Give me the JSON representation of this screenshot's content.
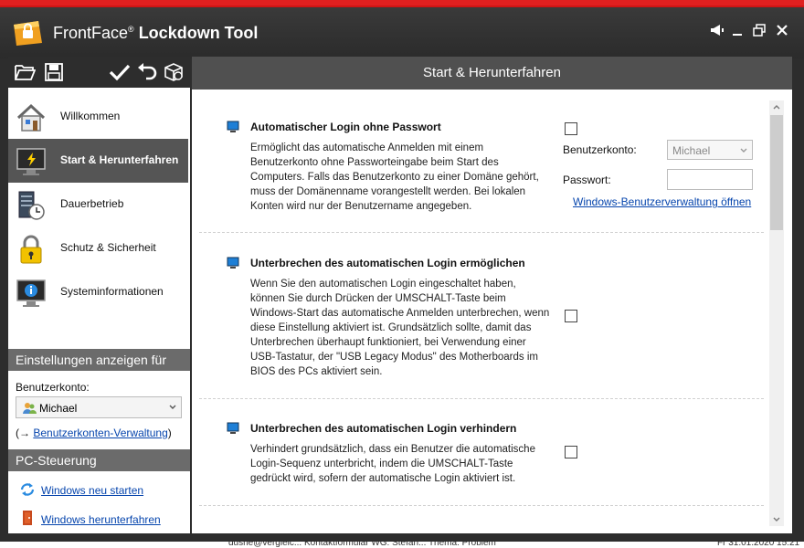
{
  "window": {
    "title_brand": "FrontFace",
    "title_reg": "®",
    "title_tool": "Lockdown Tool"
  },
  "toolbar": {
    "icons": [
      "folder-open-icon",
      "save-icon",
      "checkmark-icon",
      "undo-icon",
      "package-icon"
    ]
  },
  "nav": {
    "items": [
      {
        "label": "Willkommen",
        "icon": "house-icon"
      },
      {
        "label": "Start & Herunterfahren",
        "icon": "monitor-power-icon"
      },
      {
        "label": "Dauerbetrieb",
        "icon": "server-clock-icon"
      },
      {
        "label": "Schutz & Sicherheit",
        "icon": "padlock-icon"
      },
      {
        "label": "Systeminformationen",
        "icon": "info-monitor-icon"
      }
    ]
  },
  "settings_for": {
    "heading": "Einstellungen anzeigen für",
    "account_label": "Benutzerkonto:",
    "account_value": "Michael",
    "link_prefix": "(→ ",
    "link_text": "Benutzerkonten-Verwaltung",
    "link_suffix": ")"
  },
  "pc_control": {
    "heading": "PC-Steuerung",
    "restart_label": "Windows neu starten",
    "shutdown_label": "Windows herunterfahren"
  },
  "main": {
    "heading": "Start & Herunterfahren",
    "sections": [
      {
        "title": "Automatischer Login ohne Passwort",
        "description": "Ermöglicht das automatische Anmelden mit einem Benutzerkonto ohne Passworteingabe beim Start des Computers. Falls das Benutzerkonto zu einer Domäne gehört, muss der Domänenname vorangestellt werden. Bei lokalen Konten wird nur der Benutzername angegeben.",
        "checked": false,
        "account_label": "Benutzerkonto:",
        "account_value": "Michael",
        "password_label": "Passwort:",
        "password_value": "",
        "link": "Windows-Benutzerverwaltung öffnen"
      },
      {
        "title": "Unterbrechen des automatischen Login ermöglichen",
        "description": "Wenn Sie den automatischen Login eingeschaltet haben, können Sie durch Drücken der UMSCHALT-Taste beim Windows-Start das automatische Anmelden unterbrechen, wenn diese Einstellung aktiviert ist. Grundsätzlich sollte, damit das Unterbrechen überhaupt funktioniert, bei Verwendung einer USB-Tastatur, der \"USB Legacy Modus\" des Motherboards im BIOS des PCs aktiviert sein.",
        "checked": false
      },
      {
        "title": "Unterbrechen des automatischen Login verhindern",
        "description": "Verhindert grundsätzlich, dass ein Benutzer die automatische Login-Sequenz unterbricht, indem die UMSCHALT-Taste gedrückt wird, sofern der automatische Login aktiviert ist.",
        "checked": false
      }
    ]
  },
  "background_window": {
    "bottom_text": "dusne@vergleic... Kontaktformular WG: Stefan... Thema: Problem",
    "date_text": "Fr 31.01.2020 15:21"
  },
  "colors": {
    "titlebar": "#2d2d2d",
    "accent_red": "#e02020",
    "active_nav": "#555555",
    "link": "#0645ad"
  }
}
